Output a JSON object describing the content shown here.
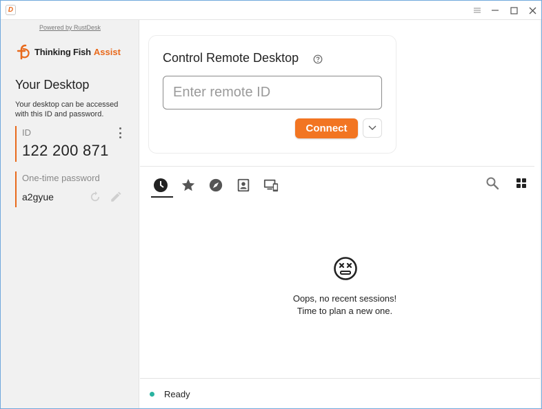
{
  "app": {
    "icon_glyph": "D",
    "colors": {
      "accent": "#f27522",
      "status_ok": "#2ab3a0"
    }
  },
  "sidebar": {
    "powered_by": "Powered by RustDesk",
    "brand_name": "Thinking Fish",
    "brand_accent": "Assist",
    "heading": "Your Desktop",
    "description": "Your desktop can be accessed with this ID and password.",
    "id_label": "ID",
    "id_value": "122 200 871",
    "password_label": "One-time password",
    "password_value": "a2gyue"
  },
  "connect": {
    "title": "Control Remote Desktop",
    "input_placeholder": "Enter remote ID",
    "input_value": "",
    "connect_label": "Connect"
  },
  "tabs": [
    {
      "name": "recent-sessions",
      "icon": "clock-icon",
      "active": true
    },
    {
      "name": "favorites",
      "icon": "star-icon",
      "active": false
    },
    {
      "name": "discovered",
      "icon": "compass-icon",
      "active": false
    },
    {
      "name": "address-book",
      "icon": "contact-book-icon",
      "active": false
    },
    {
      "name": "group",
      "icon": "devices-icon",
      "active": false
    }
  ],
  "empty_state": {
    "line1": "Oops, no recent sessions!",
    "line2": "Time to plan a new one."
  },
  "status": {
    "text": "Ready"
  }
}
